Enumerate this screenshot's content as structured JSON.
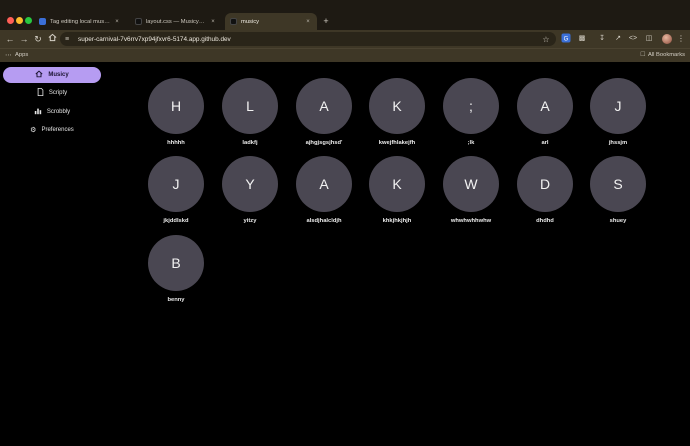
{
  "browser": {
    "tabs": [
      {
        "title": "Tag editing local music files",
        "close": "×"
      },
      {
        "title": "layout.css — Musicy [Codespaces]",
        "close": "×"
      },
      {
        "title": "musicy",
        "close": "×"
      }
    ],
    "new_tab_glyph": "+",
    "url": "super-carnival-7v6rrv7xp94jfxvr6-5174.app.github.dev",
    "bookmarks": {
      "apps_label": "Apps",
      "all_label": "All Bookmarks"
    }
  },
  "sidebar": {
    "items": [
      {
        "label": "Musicy",
        "icon": "home-icon",
        "active": true
      },
      {
        "label": "Scripty",
        "icon": "document-icon",
        "active": false
      },
      {
        "label": "Scrobbly",
        "icon": "bar-chart-icon",
        "active": false
      },
      {
        "label": "Preferences",
        "icon": "gear-icon",
        "active": false
      }
    ]
  },
  "artists": [
    {
      "initial": "H",
      "name": "hhhhh"
    },
    {
      "initial": "L",
      "name": "ladkfj"
    },
    {
      "initial": "A",
      "name": "ajhgjsgsjhsd'"
    },
    {
      "initial": "K",
      "name": "kwejfhlakejfh"
    },
    {
      "initial": ";",
      "name": ";lk"
    },
    {
      "initial": "A",
      "name": "arl"
    },
    {
      "initial": "J",
      "name": "jhssjm"
    },
    {
      "initial": "J",
      "name": "jkjddlskd"
    },
    {
      "initial": "Y",
      "name": "yitzy"
    },
    {
      "initial": "A",
      "name": "alsdjhalcldjh"
    },
    {
      "initial": "K",
      "name": "khkjhkjhjh"
    },
    {
      "initial": "W",
      "name": "whwhwhhwhw"
    },
    {
      "initial": "D",
      "name": "dhdhd"
    },
    {
      "initial": "S",
      "name": "shuey"
    },
    {
      "initial": "B",
      "name": "benny"
    }
  ],
  "colors": {
    "accent": "#b69cf2",
    "avatar_bg": "#4a4752",
    "chrome": "#3e3726"
  }
}
